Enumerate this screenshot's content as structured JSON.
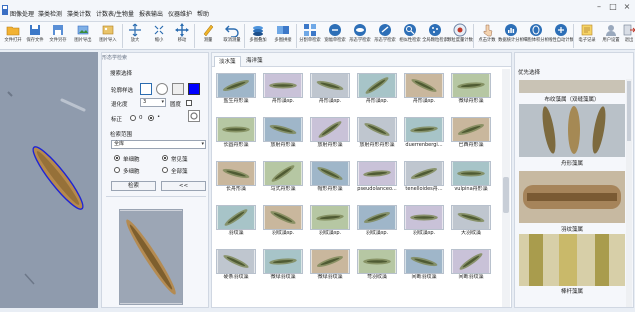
{
  "menubar": {
    "items": [
      "图像处理",
      "藻类检测",
      "藻类计数",
      "计数表/生物量",
      "报表输出",
      "仪器维护",
      "帮助"
    ],
    "window_controls": [
      "minimize-icon",
      "maximize-icon",
      "close-icon"
    ]
  },
  "toolbar": {
    "buttons": [
      {
        "label": "文件打开",
        "icon": "folder-open-icon"
      },
      {
        "label": "保存文件",
        "icon": "save-icon"
      },
      {
        "label": "文件另存",
        "icon": "save-as-icon"
      },
      {
        "label": "图片导出",
        "icon": "image-export-icon"
      },
      {
        "label": "图片导入",
        "icon": "image-import-icon"
      },
      {
        "label": "放大",
        "icon": "zoom-in-icon"
      },
      {
        "label": "缩小",
        "icon": "zoom-out-icon"
      },
      {
        "label": "移动",
        "icon": "move-icon"
      },
      {
        "label": "测量",
        "icon": "measure-icon"
      },
      {
        "label": "取消测量",
        "icon": "undo-icon"
      },
      {
        "label": "多图叠加",
        "icon": "layers-icon"
      },
      {
        "label": "多图拼接",
        "icon": "stitch-icon"
      },
      {
        "label": "分割单检索",
        "icon": "grid-search-icon"
      },
      {
        "label": "宽幅单检索",
        "icon": "wide-search-icon"
      },
      {
        "label": "形态学检索",
        "icon": "morphology-icon"
      },
      {
        "label": "形态学检索",
        "icon": "morphology2-icon"
      },
      {
        "label": "相似性检索",
        "icon": "similarity-icon"
      },
      {
        "label": "全局颗粒检索",
        "icon": "particle-icon"
      },
      {
        "label": "颗粒度量计数",
        "icon": "measure-count-icon"
      },
      {
        "label": "点击计数",
        "icon": "click-count-icon"
      },
      {
        "label": "数据统计分析",
        "icon": "statistics-icon"
      },
      {
        "label": "细胞体积分析",
        "icon": "cell-volume-icon"
      },
      {
        "label": "线性自动计数",
        "icon": "auto-count-icon"
      },
      {
        "label": "电子记录",
        "icon": "notebook-icon"
      },
      {
        "label": "用户设置",
        "icon": "user-settings-icon"
      },
      {
        "label": "退出",
        "icon": "exit-icon"
      }
    ]
  },
  "params": {
    "title": "形态学检索",
    "section1": "搜索选择",
    "outline_label": "轮廓样选",
    "smooth_label": "退化度",
    "smooth_value": "3",
    "fill_label": "圆度",
    "rotate_label": "标正",
    "rotate_opt1": "0",
    "rotate_opt2": "",
    "section2": "检索范围",
    "range_value": "全库",
    "radio1": "单细胞",
    "radio2": "常见藻",
    "radio3": "多细胞",
    "radio4": "全部藻",
    "search_btn": "检索",
    "back_btn": "<<"
  },
  "gallery": {
    "tabs": [
      "淡水藻",
      "海洋藻"
    ],
    "active_tab": 0,
    "captions": [
      "盐生舟形藻",
      "舟形藻sp.",
      "舟形藻sp.",
      "舟形藻sp.",
      "舟形藻sp.",
      "微绿舟形藻",
      "长圆舟形藻",
      "放射舟形藻",
      "放射舟形藻",
      "放射舟形舟形藻",
      "duerrenbergi...",
      "巴西舟形藻",
      "长舟形藻",
      "马式舟形藻",
      "帽形舟形藻",
      "pseudolanceo...",
      "tenelloides舟...",
      "vulpina舟形藻",
      "羽纹藻",
      "羽纹藻sp.",
      "羽纹藻sp.",
      "羽纹藻sp.",
      "羽纹藻sp.",
      "大羽纹藻",
      "硬条羽纹藻",
      "微绿羽纹藻",
      "微绿羽纹藻",
      "弯羽纹藻",
      "间断羽纹藻",
      "间断羽纹藻"
    ]
  },
  "preview": {
    "title": "优先选择",
    "captions": [
      "布纹藻属（双缝藻属）",
      "舟形藻属",
      "羽纹藻属",
      "棒杆藻属"
    ]
  },
  "colors": {
    "accent": "#2b6cb0",
    "outline_selected": "#1e24d6",
    "color_swatch": "#0000ff"
  }
}
